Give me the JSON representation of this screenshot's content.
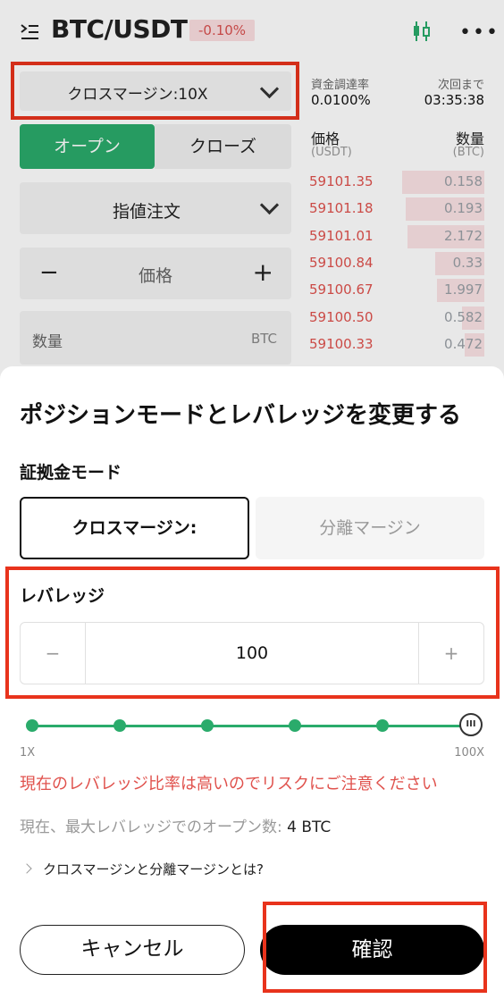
{
  "header": {
    "pair": "BTC/USDT",
    "change": "-0.10%"
  },
  "trade": {
    "margin_mode_label": "クロスマージン:10X",
    "tab_open": "オープン",
    "tab_close": "クローズ",
    "order_type": "指値注文",
    "price_placeholder": "価格",
    "price_minus": "−",
    "price_plus": "+",
    "quantity_label": "数量",
    "quantity_unit": "BTC"
  },
  "funding": {
    "rate_label": "資金調達率",
    "rate_value": "0.0100%",
    "next_label": "次回まで",
    "next_value": "03:35:38"
  },
  "orderbook": {
    "price_header": "価格",
    "price_unit": "(USDT)",
    "qty_header": "数量",
    "qty_unit": "(BTC)",
    "asks": [
      {
        "price": "59101.35",
        "qty": "0.158",
        "depth": 0.47
      },
      {
        "price": "59101.18",
        "qty": "0.193",
        "depth": 0.45
      },
      {
        "price": "59101.01",
        "qty": "2.172",
        "depth": 0.44
      },
      {
        "price": "59100.84",
        "qty": "0.33",
        "depth": 0.28
      },
      {
        "price": "59100.67",
        "qty": "1.997",
        "depth": 0.27
      },
      {
        "price": "59100.50",
        "qty": "0.582",
        "depth": 0.13
      },
      {
        "price": "59100.33",
        "qty": "0.472",
        "depth": 0.11
      }
    ]
  },
  "sheet": {
    "title": "ポジションモードとレバレッジを変更する",
    "mode_label": "証拠金モード",
    "mode_cross": "クロスマージン:",
    "mode_isolated": "分離マージン",
    "leverage_label": "レバレッジ",
    "leverage_minus": "−",
    "leverage_value": "100",
    "leverage_plus": "+",
    "slider_min": "1X",
    "slider_max": "100X",
    "slider_level": 1.0,
    "warning": "現在のレバレッジ比率は高いのでリスクにご注意ください",
    "max_open_label": "現在、最大レバレッジでのオープン数:",
    "max_open_value": "4 BTC",
    "faq_link": "クロスマージンと分離マージンとは?",
    "cancel": "キャンセル",
    "confirm": "確認"
  },
  "colors": {
    "accent": "#2aab6b",
    "sell": "#e0524d",
    "highlight": "#e8331c"
  }
}
